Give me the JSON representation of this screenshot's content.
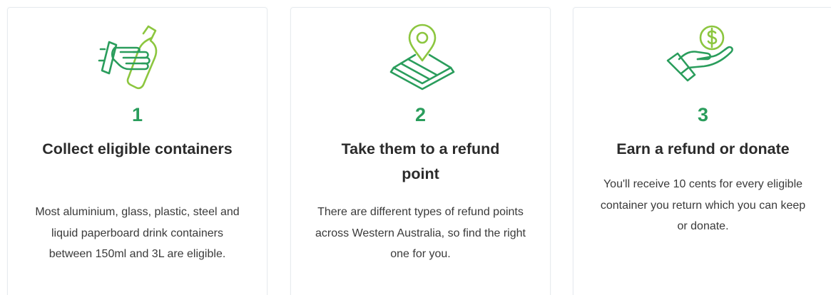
{
  "colors": {
    "accent_green": "#2a9d5c",
    "lime_green": "#8cc63f",
    "title_text": "#2b2b2b",
    "body_text": "#3a3a3a",
    "card_border": "#e7ebef"
  },
  "steps": [
    {
      "icon": "hand-holding-bottle-icon",
      "number": "1",
      "title": "Collect eligible containers",
      "text": "Most aluminium, glass, plastic, steel and liquid paperboard drink containers between 150ml and 3L are eligible."
    },
    {
      "icon": "map-location-pin-icon",
      "number": "2",
      "title": "Take them to a refund point",
      "text": "There are different types of refund points across Western Australia, so find the right one for you."
    },
    {
      "icon": "hand-holding-coin-icon",
      "number": "3",
      "title": "Earn a refund or donate",
      "text": "You'll receive 10 cents for every eligible container you return which you can keep or donate."
    }
  ]
}
